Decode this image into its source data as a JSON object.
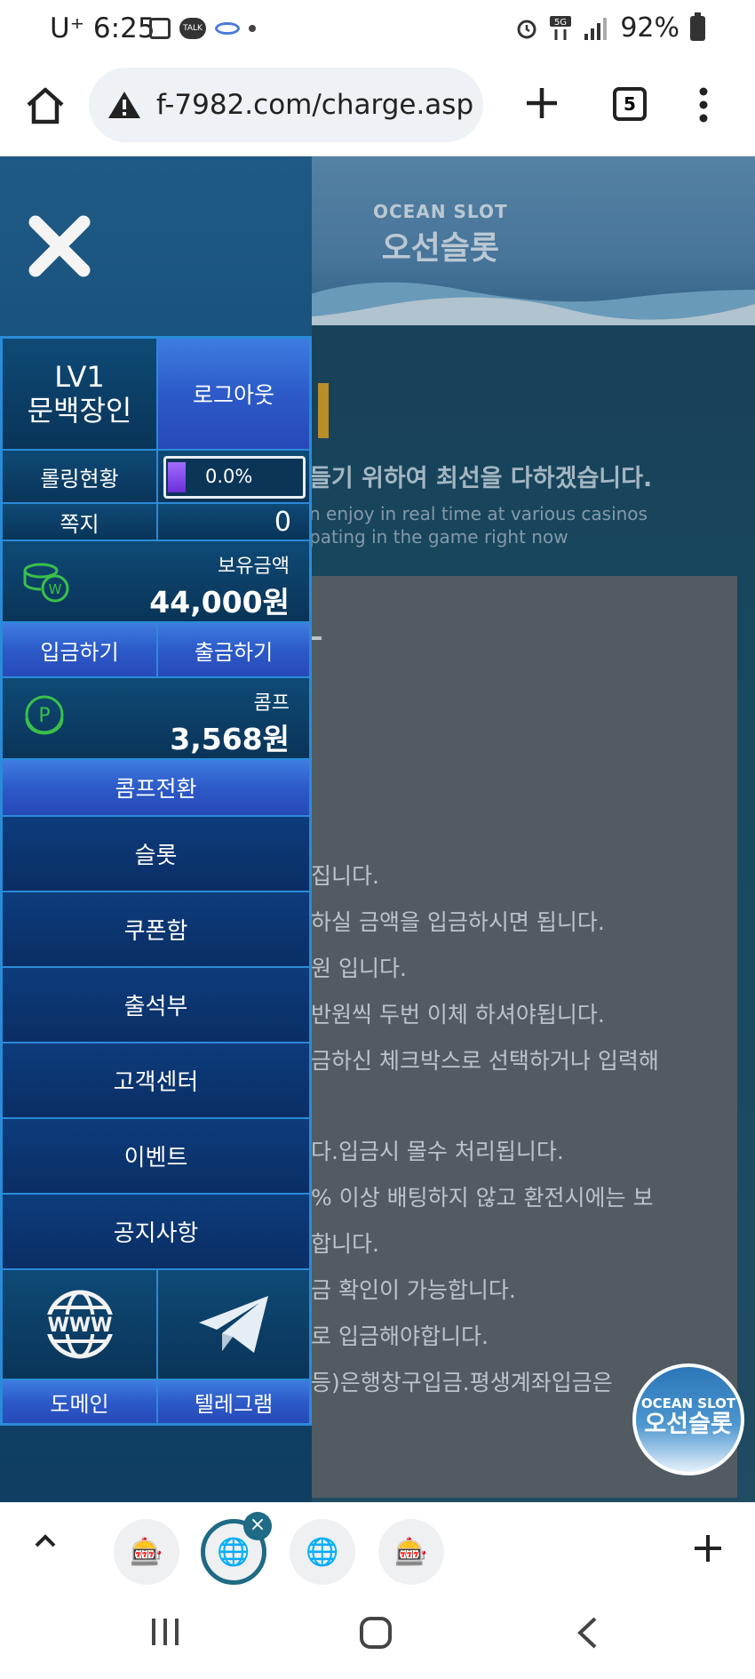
{
  "status_bar": {
    "carrier": "U⁺",
    "time": "6:25",
    "battery": "92%"
  },
  "browser": {
    "url": "f-7982.com/charge.asp",
    "tab_count": "5"
  },
  "site": {
    "logo_en": "OCEAN SLOT",
    "logo_ko": "오선슬롯",
    "hero_ko": "들기 위하여 최선을 다하겠습니다.",
    "hero_en_line1": "n enjoy in real time at various casinos",
    "hero_en_line2": "pating in the game right now",
    "notices": [
      "집니다.",
      "하실 금액을 입금하시면 됩니다.",
      "원 입니다.",
      "반원씩 두번 이체 하셔야됩니다.",
      "금하신 체크박스로 선택하거나 입력해",
      "다.입금시 몰수 처리됩니다.",
      "% 이상 배팅하지 않고 환전시에는 보",
      "합니다.",
      "금 확인이 가능합니다.",
      "로 입금해야합니다.",
      "등)은행창구입금.평생계좌입금은 "
    ]
  },
  "drawer": {
    "level": "LV1",
    "username": "문백장인",
    "logout": "로그아웃",
    "rolling_label": "롤링현황",
    "rolling_value": "0.0%",
    "rolling_fraction": 0.0,
    "message_label": "쪽지",
    "message_count": "0",
    "balance_label": "보유금액",
    "balance_value": "44,000원",
    "deposit": "입금하기",
    "withdraw": "출금하기",
    "comp_label": "콤프",
    "comp_value": "3,568원",
    "comp_convert": "콤프전환",
    "menu": [
      "슬롯",
      "쿠폰함",
      "출석부",
      "고객센터",
      "이벤트",
      "공지사항"
    ],
    "domain": "도메인",
    "telegram": "텔레그램",
    "www_icon_text": "WWW"
  },
  "floating_logo": {
    "en": "OCEAN SLOT",
    "ko": "오선슬롯"
  },
  "colors": {
    "accent": "#2a8bd8",
    "drawer_bg": "#124a72",
    "button_blue": "#2c5ac8"
  }
}
